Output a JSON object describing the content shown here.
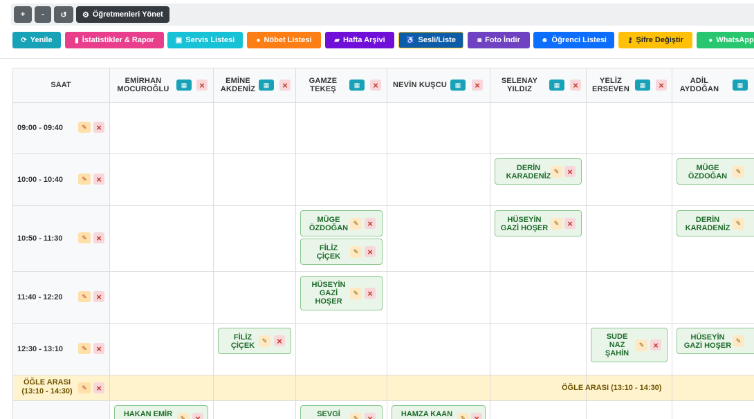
{
  "toolbar": {
    "plus": "+",
    "minus": "-",
    "reset": "↺",
    "manage_icon": "gear-icon",
    "manage_label": "Öğretmenleri Yönet"
  },
  "actions": [
    {
      "label": "Yenile",
      "icon": "refresh-icon",
      "color": "#17a2b8"
    },
    {
      "label": "İstatistikler & Rapor",
      "icon": "chart-icon",
      "color": "#e83e8c"
    },
    {
      "label": "Servis Listesi",
      "icon": "bus-icon",
      "color": "#17c1d6"
    },
    {
      "label": "Nöbet Listesi",
      "icon": "shield-icon",
      "color": "#fd7e14"
    },
    {
      "label": "Hafta Arşivi",
      "icon": "folder-icon",
      "color": "#6f0fd8"
    },
    {
      "label": "Sesli/Liste",
      "icon": "accessibility-icon",
      "color": "#0d5ca8"
    },
    {
      "label": "Foto İndir",
      "icon": "camera-icon",
      "color": "#6f42c1"
    },
    {
      "label": "Öğrenci Listesi",
      "icon": "users-icon",
      "color": "#0d6efd"
    },
    {
      "label": "Şifre Değiştir",
      "icon": "key-icon",
      "color": "#ffc107"
    },
    {
      "label": "WhatsApp",
      "icon": "chat-icon",
      "color": "#28c76f"
    }
  ],
  "schedule": {
    "time_header": "SAAT",
    "teachers": [
      {
        "line1": "EMİRHAN",
        "line2": "MOCUROĞLU"
      },
      {
        "line1": "EMİNE",
        "line2": "AKDENİZ"
      },
      {
        "line1": "GAMZE",
        "line2": "TEKEŞ"
      },
      {
        "line1": "NEVİN KUŞCU",
        "line2": ""
      },
      {
        "line1": "SELENAY",
        "line2": "YILDIZ"
      },
      {
        "line1": "YELİZ",
        "line2": "ERSEVEN"
      },
      {
        "line1": "ADİL",
        "line2": "AYDOĞAN"
      }
    ],
    "times": [
      "09:00 - 09:40",
      "10:00 - 10:40",
      "10:50 - 11:30",
      "11:40 - 12:20",
      "12:30 - 13:10"
    ],
    "lunch": {
      "left_line1": "ÖĞLE ARASI",
      "left_line2": "(13:10 - 14:30)",
      "center": "ÖĞLE ARASI (13:10 - 14:30)"
    },
    "students": [
      {
        "lines": [
          "DERİN",
          "KARADENİZ"
        ]
      },
      {
        "lines": [
          "MÜGE",
          "ÖZDOĞAN"
        ]
      },
      {
        "lines": [
          "MÜGE",
          "ÖZDOĞAN"
        ]
      },
      {
        "lines": [
          "HÜSEYİN",
          "GAZİ HOŞER"
        ]
      },
      {
        "lines": [
          "DERİN",
          "KARADENİZ"
        ]
      },
      {
        "lines": [
          "FİLİZ",
          "ÇİÇEK"
        ]
      },
      {
        "lines": [
          "HÜSEYİN",
          "GAZİ",
          "HOŞER"
        ]
      },
      {
        "lines": [
          "FİLİZ",
          "ÇİÇEK"
        ]
      },
      {
        "lines": [
          "SUDE",
          "NAZ",
          "ŞAHİN"
        ]
      },
      {
        "lines": [
          "HÜSEYİN",
          "GAZİ HOŞER"
        ]
      },
      {
        "lines": [
          "HAKAN EMİR"
        ]
      },
      {
        "lines": [
          "SEVGİ"
        ]
      },
      {
        "lines": [
          "HAMZA KAAN"
        ]
      }
    ]
  }
}
